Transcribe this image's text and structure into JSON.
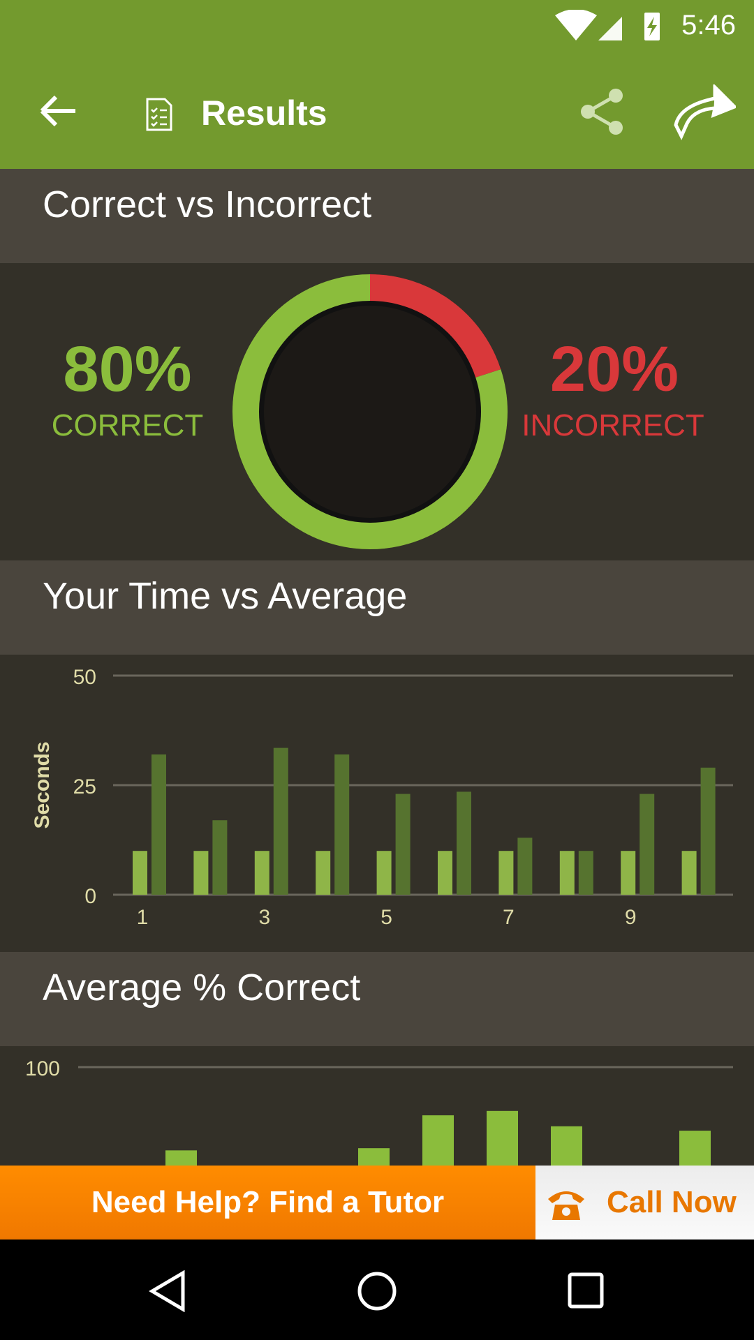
{
  "status_bar": {
    "time": "5:46",
    "icons": [
      "wifi-icon",
      "signal-icon",
      "battery-charging-icon"
    ]
  },
  "toolbar": {
    "title": "Results",
    "icons": [
      "back-arrow-icon",
      "document-checklist-icon",
      "share-icon",
      "forward-icon"
    ]
  },
  "sections": {
    "correct": {
      "title": "Correct vs Incorrect",
      "correct_pct": "80%",
      "correct_label": "CORRECT",
      "incorrect_pct": "20%",
      "incorrect_label": "INCORRECT"
    },
    "time": {
      "title": "Your Time vs Average"
    },
    "avg": {
      "title": "Average % Correct"
    }
  },
  "banner": {
    "left": "Need Help? Find a Tutor",
    "right": "Call Now",
    "icon": "phone-icon"
  },
  "colors": {
    "toolbar": "#739a2e",
    "correct": "#8bbd3c",
    "incorrect": "#d9383a",
    "bar_light": "#8fb548",
    "bar_dark": "#56732f",
    "banner": "#f78800"
  },
  "chart_data": [
    {
      "type": "pie",
      "style": "donut",
      "values": [
        80,
        20
      ],
      "labels": [
        "CORRECT",
        "INCORRECT"
      ],
      "colors": [
        "#8bbd3c",
        "#d9383a"
      ]
    },
    {
      "type": "bar",
      "ylabel": "Seconds",
      "ylim": [
        0,
        50
      ],
      "yticks": [
        "0",
        "25",
        "50"
      ],
      "xticks": [
        "1",
        "3",
        "5",
        "7",
        "9"
      ],
      "categories": [
        1,
        2,
        3,
        4,
        5,
        6,
        7,
        8,
        9,
        10
      ],
      "grid": true,
      "series": [
        {
          "values": [
            10,
            10,
            10,
            10,
            10,
            10,
            10,
            10,
            10,
            10
          ],
          "color": "#8fb548"
        },
        {
          "values": [
            32,
            17,
            33.5,
            32,
            23,
            23.5,
            13,
            10,
            23,
            29
          ],
          "color": "#56732f"
        }
      ]
    },
    {
      "type": "bar",
      "ylim": [
        0,
        100
      ],
      "yticks": [
        "100"
      ],
      "categories": [
        1,
        2,
        3,
        4,
        5,
        6,
        7,
        8,
        9,
        10
      ],
      "grid": true,
      "values": [
        null,
        62,
        null,
        null,
        63,
        78,
        80,
        73,
        null,
        71
      ],
      "color": "#8bbd3c"
    }
  ]
}
